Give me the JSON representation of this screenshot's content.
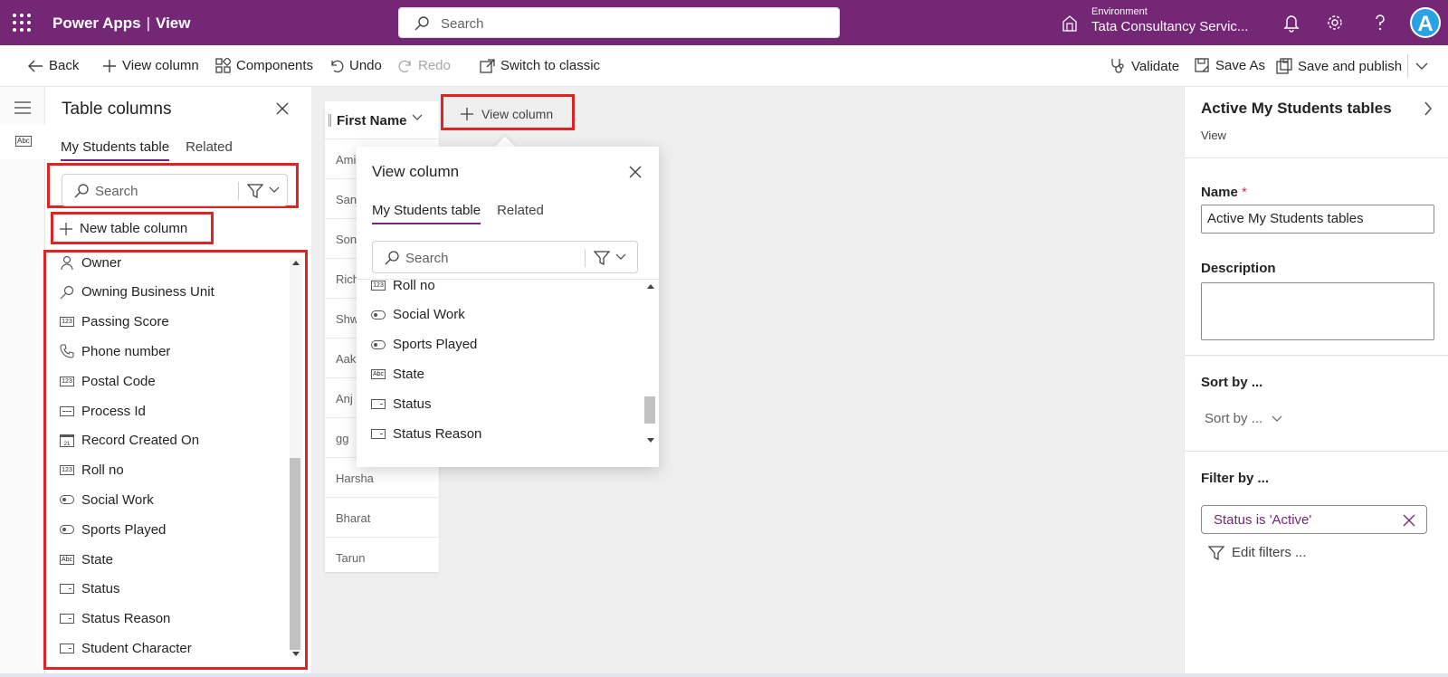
{
  "header": {
    "app_name": "Power Apps",
    "separator": "|",
    "section": "View",
    "search_placeholder": "Search",
    "env_label": "Environment",
    "env_name": "Tata Consultancy Servic...",
    "avatar_letter": "A",
    "brand_color": "#742774"
  },
  "commands": {
    "back": "Back",
    "view_column": "View column",
    "components": "Components",
    "undo": "Undo",
    "redo": "Redo",
    "switch_classic": "Switch to classic",
    "validate": "Validate",
    "save_as": "Save As",
    "save_publish": "Save and publish"
  },
  "left_panel": {
    "title": "Table columns",
    "tabs": [
      "My Students table",
      "Related"
    ],
    "search_placeholder": "Search",
    "new_column": "New table column",
    "columns": [
      {
        "label": "Owner",
        "icon": "person-icon"
      },
      {
        "label": "Owning Business Unit",
        "icon": "lookup-icon"
      },
      {
        "label": "Passing Score",
        "icon": "number-icon"
      },
      {
        "label": "Phone number",
        "icon": "phone-icon"
      },
      {
        "label": "Postal Code",
        "icon": "number-icon"
      },
      {
        "label": "Process Id",
        "icon": "unique-id-icon"
      },
      {
        "label": "Record Created On",
        "icon": "calendar-icon"
      },
      {
        "label": "Roll no",
        "icon": "number-icon"
      },
      {
        "label": "Social Work",
        "icon": "toggle-icon"
      },
      {
        "label": "Sports Played",
        "icon": "toggle-icon"
      },
      {
        "label": "State",
        "icon": "text-icon"
      },
      {
        "label": "Status",
        "icon": "choice-icon"
      },
      {
        "label": "Status Reason",
        "icon": "choice-icon"
      },
      {
        "label": "Student Character",
        "icon": "choice-icon"
      }
    ]
  },
  "grid": {
    "column_header": "First Name",
    "add_column": "View column",
    "rows": [
      "Ami",
      "Sanj",
      "Soni",
      "Rich",
      "Shw",
      "Aak",
      "Anj",
      "gg",
      "Harsha",
      "Bharat",
      "Tarun"
    ]
  },
  "popover": {
    "title": "View column",
    "tabs": [
      "My Students table",
      "Related"
    ],
    "search_placeholder": "Search",
    "columns": [
      {
        "label": "Roll no",
        "icon": "number-icon"
      },
      {
        "label": "Social Work",
        "icon": "toggle-icon"
      },
      {
        "label": "Sports Played",
        "icon": "toggle-icon"
      },
      {
        "label": "State",
        "icon": "text-icon"
      },
      {
        "label": "Status",
        "icon": "choice-icon"
      },
      {
        "label": "Status Reason",
        "icon": "choice-icon"
      }
    ]
  },
  "right_panel": {
    "title": "Active My Students tables",
    "subtitle": "View",
    "name_label": "Name",
    "required_mark": "*",
    "name_value": "Active My Students tables",
    "description_label": "Description",
    "description_value": "",
    "sort_heading": "Sort by ...",
    "sort_dropdown": "Sort by ...",
    "filter_heading": "Filter by ...",
    "filter_value": "Status is 'Active'",
    "edit_filters": "Edit filters ..."
  }
}
